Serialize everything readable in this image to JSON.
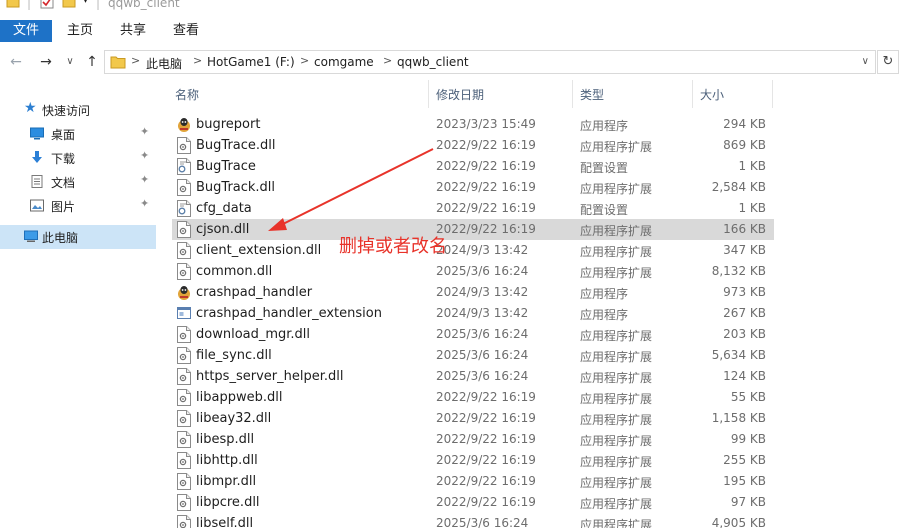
{
  "window": {
    "title": "qqwb_client"
  },
  "ribbon": {
    "tabs": [
      "文件",
      "主页",
      "共享",
      "查看"
    ]
  },
  "address": {
    "crumbs": [
      "此电脑",
      "HotGame1 (F:)",
      "comgame",
      "qqwb_client"
    ],
    "separator": ">"
  },
  "nav": {
    "back": "←",
    "forward": "→",
    "recent": "∨",
    "up": "↑",
    "refresh": "↻"
  },
  "sidebar": {
    "items": [
      {
        "label": "快速访问",
        "icon": "star-icon",
        "pinned": false
      },
      {
        "label": "桌面",
        "icon": "desktop-icon",
        "pinned": true
      },
      {
        "label": "下载",
        "icon": "download-icon",
        "pinned": true
      },
      {
        "label": "文档",
        "icon": "document-icon",
        "pinned": true
      },
      {
        "label": "图片",
        "icon": "picture-icon",
        "pinned": true
      },
      {
        "label": "此电脑",
        "icon": "computer-icon",
        "pinned": false
      }
    ],
    "pin_glyph": "📌"
  },
  "columns": {
    "name": "名称",
    "date": "修改日期",
    "type": "类型",
    "size": "大小"
  },
  "files": [
    {
      "name": "bugreport",
      "date": "2023/3/23 15:49",
      "type": "应用程序",
      "size": "294 KB",
      "icon": "app-icon"
    },
    {
      "name": "BugTrace.dll",
      "date": "2022/9/22 16:19",
      "type": "应用程序扩展",
      "size": "869 KB",
      "icon": "dll-icon"
    },
    {
      "name": "BugTrace",
      "date": "2022/9/22 16:19",
      "type": "配置设置",
      "size": "1 KB",
      "icon": "config-icon"
    },
    {
      "name": "BugTrack.dll",
      "date": "2022/9/22 16:19",
      "type": "应用程序扩展",
      "size": "2,584 KB",
      "icon": "dll-icon"
    },
    {
      "name": "cfg_data",
      "date": "2022/9/22 16:19",
      "type": "配置设置",
      "size": "1 KB",
      "icon": "config-icon"
    },
    {
      "name": "cjson.dll",
      "date": "2022/9/22 16:19",
      "type": "应用程序扩展",
      "size": "166 KB",
      "icon": "dll-icon",
      "selected": true
    },
    {
      "name": "client_extension.dll",
      "date": "2024/9/3 13:42",
      "type": "应用程序扩展",
      "size": "347 KB",
      "icon": "dll-icon"
    },
    {
      "name": "common.dll",
      "date": "2025/3/6 16:24",
      "type": "应用程序扩展",
      "size": "8,132 KB",
      "icon": "dll-icon"
    },
    {
      "name": "crashpad_handler",
      "date": "2024/9/3 13:42",
      "type": "应用程序",
      "size": "973 KB",
      "icon": "app-icon"
    },
    {
      "name": "crashpad_handler_extension",
      "date": "2024/9/3 13:42",
      "type": "应用程序",
      "size": "267 KB",
      "icon": "window-app-icon"
    },
    {
      "name": "download_mgr.dll",
      "date": "2025/3/6 16:24",
      "type": "应用程序扩展",
      "size": "203 KB",
      "icon": "dll-icon"
    },
    {
      "name": "file_sync.dll",
      "date": "2025/3/6 16:24",
      "type": "应用程序扩展",
      "size": "5,634 KB",
      "icon": "dll-icon"
    },
    {
      "name": "https_server_helper.dll",
      "date": "2025/3/6 16:24",
      "type": "应用程序扩展",
      "size": "124 KB",
      "icon": "dll-icon"
    },
    {
      "name": "libappweb.dll",
      "date": "2022/9/22 16:19",
      "type": "应用程序扩展",
      "size": "55 KB",
      "icon": "dll-icon"
    },
    {
      "name": "libeay32.dll",
      "date": "2022/9/22 16:19",
      "type": "应用程序扩展",
      "size": "1,158 KB",
      "icon": "dll-icon"
    },
    {
      "name": "libesp.dll",
      "date": "2022/9/22 16:19",
      "type": "应用程序扩展",
      "size": "99 KB",
      "icon": "dll-icon"
    },
    {
      "name": "libhttp.dll",
      "date": "2022/9/22 16:19",
      "type": "应用程序扩展",
      "size": "255 KB",
      "icon": "dll-icon"
    },
    {
      "name": "libmpr.dll",
      "date": "2022/9/22 16:19",
      "type": "应用程序扩展",
      "size": "195 KB",
      "icon": "dll-icon"
    },
    {
      "name": "libpcre.dll",
      "date": "2022/9/22 16:19",
      "type": "应用程序扩展",
      "size": "97 KB",
      "icon": "dll-icon"
    },
    {
      "name": "libself.dll",
      "date": "2025/3/6 16:24",
      "type": "应用程序扩展",
      "size": "4,905 KB",
      "icon": "dll-icon"
    }
  ],
  "annotation": {
    "text": "删掉或者改名",
    "color": "#e8332a"
  },
  "colors": {
    "accent": "#1e72c7",
    "selected_row": "#d9d9d9",
    "sidebar_selected": "#cce4f7"
  }
}
